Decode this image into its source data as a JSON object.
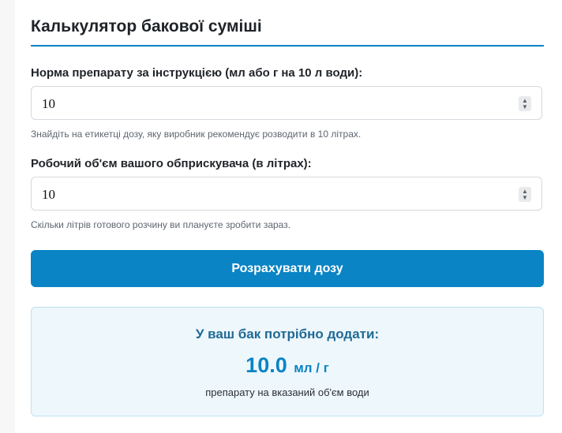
{
  "calculator": {
    "title": "Калькулятор бакової суміші",
    "dose_field": {
      "label": "Норма препарату за інструкцією (мл або г на 10 л води):",
      "value": "10",
      "hint": "Знайдіть на етикетці дозу, яку виробник рекомендує розводити в 10 літрах."
    },
    "volume_field": {
      "label": "Робочий об'єм вашого обприскувача (в літрах):",
      "value": "10",
      "hint": "Скільки літрів готового розчину ви плануєте зробити зараз."
    },
    "calculate_button": "Розрахувати дозу",
    "result": {
      "heading": "У ваш бак потрібно додати:",
      "value": "10.0",
      "unit": "мл / г",
      "note": "препарату на вказаний об'єм води"
    }
  },
  "colors": {
    "accent": "#0a84c4",
    "result_background": "#eef7fc",
    "result_border": "#bfe3f2"
  },
  "icons": {
    "spinner": "up-down-arrows-icon"
  }
}
